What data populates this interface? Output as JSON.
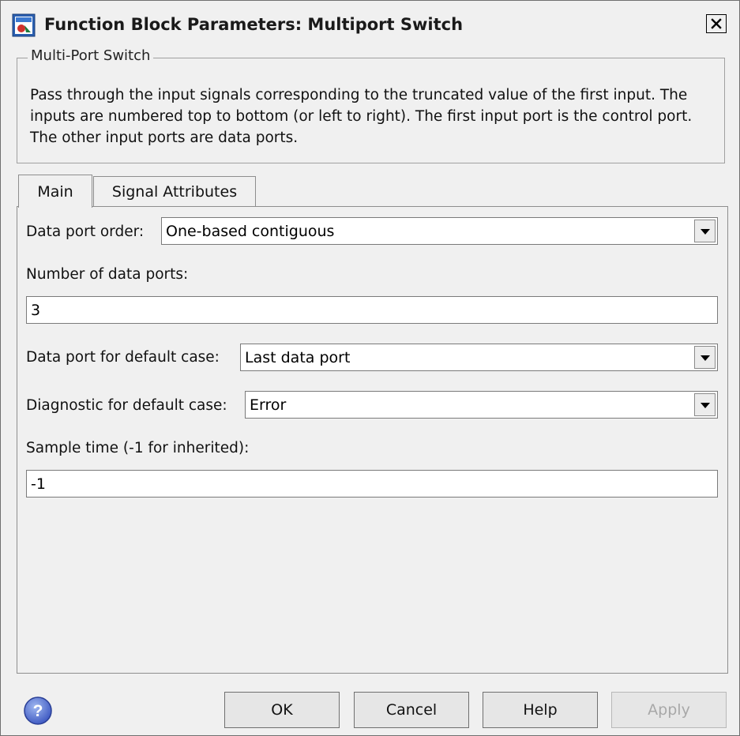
{
  "window": {
    "title": "Function Block Parameters: Multiport Switch",
    "close_glyph": "✕"
  },
  "group": {
    "title": "Multi-Port Switch",
    "description": "Pass through the input signals corresponding to the truncated value of the first input. The inputs are numbered top to bottom (or left to right). The first input port is the control port. The other input ports are data ports."
  },
  "tabs": [
    {
      "label": "Main",
      "active": true
    },
    {
      "label": "Signal Attributes",
      "active": false
    }
  ],
  "params": {
    "data_port_order": {
      "label": "Data port order:",
      "value": "One-based contiguous"
    },
    "num_data_ports": {
      "label": "Number of data ports:",
      "value": "3"
    },
    "default_case_port": {
      "label": "Data port for default case:",
      "value": "Last data port"
    },
    "diagnostic_default": {
      "label": "Diagnostic for default case:",
      "value": "Error"
    },
    "sample_time": {
      "label": "Sample time (-1 for inherited):",
      "value": "-1"
    }
  },
  "buttons": {
    "ok": "OK",
    "cancel": "Cancel",
    "help": "Help",
    "apply": "Apply"
  },
  "icons": {
    "app": "simulink-block-icon",
    "help": "help-question-icon",
    "dropdown": "chevron-down-icon"
  },
  "colors": {
    "window_bg": "#f0f0f0",
    "field_bg": "#ffffff",
    "disabled_text": "#a8a8a8"
  }
}
